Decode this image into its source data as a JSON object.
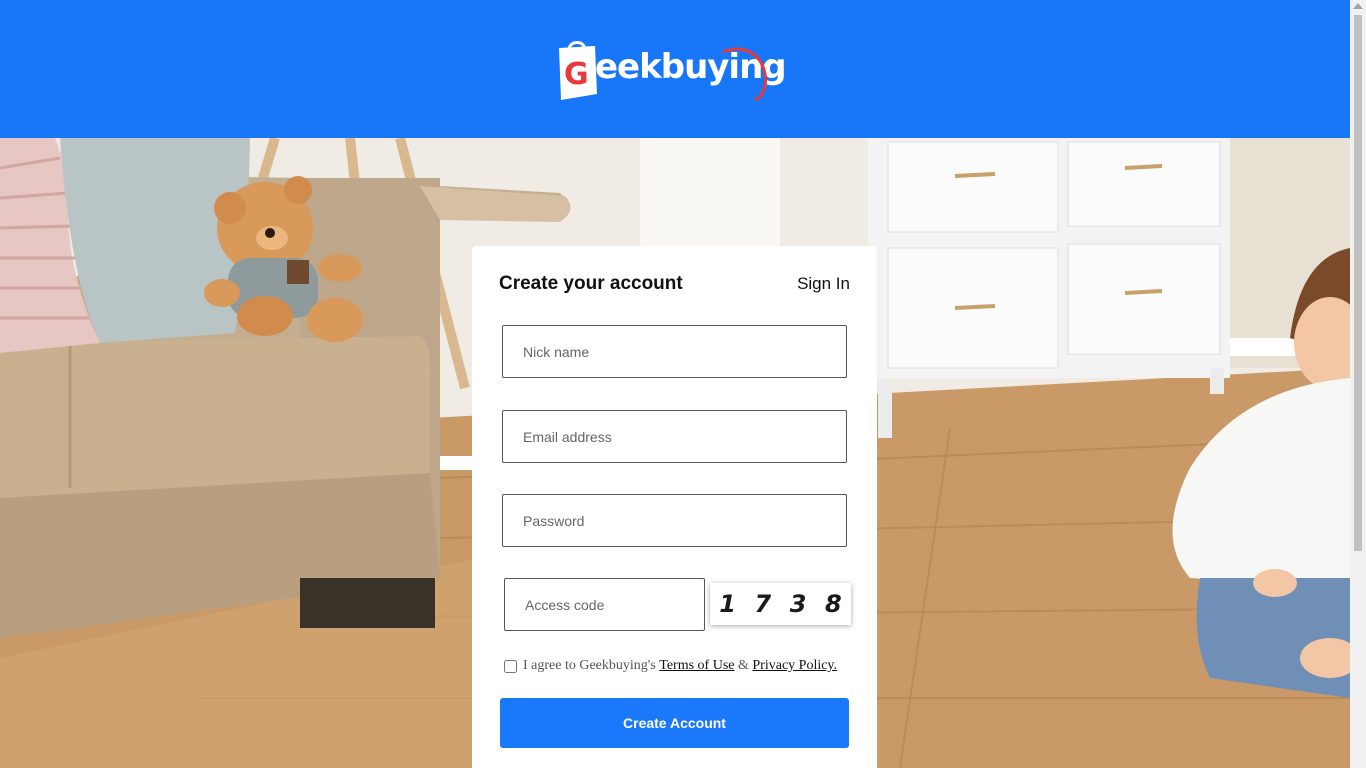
{
  "header": {
    "brand_name": "Geekbuying",
    "bag_letter": "G",
    "brand_rest": "eekbuying"
  },
  "form": {
    "title": "Create your account",
    "sign_in_label": "Sign In",
    "nick_name_placeholder": "Nick name",
    "email_placeholder": "Email address",
    "password_placeholder": "Password",
    "access_code_placeholder": "Access code",
    "captcha_digits": [
      "1",
      "7",
      "3",
      "8"
    ],
    "agree_text": "I agree to Geekbuying's",
    "terms_label": "Terms of Use",
    "ampersand": "&",
    "privacy_label": "Privacy Policy.",
    "submit_label": "Create Account"
  },
  "colors": {
    "brand_blue": "#1877f8",
    "accent_red": "#e8383b",
    "button_blue": "#1a78fa"
  }
}
